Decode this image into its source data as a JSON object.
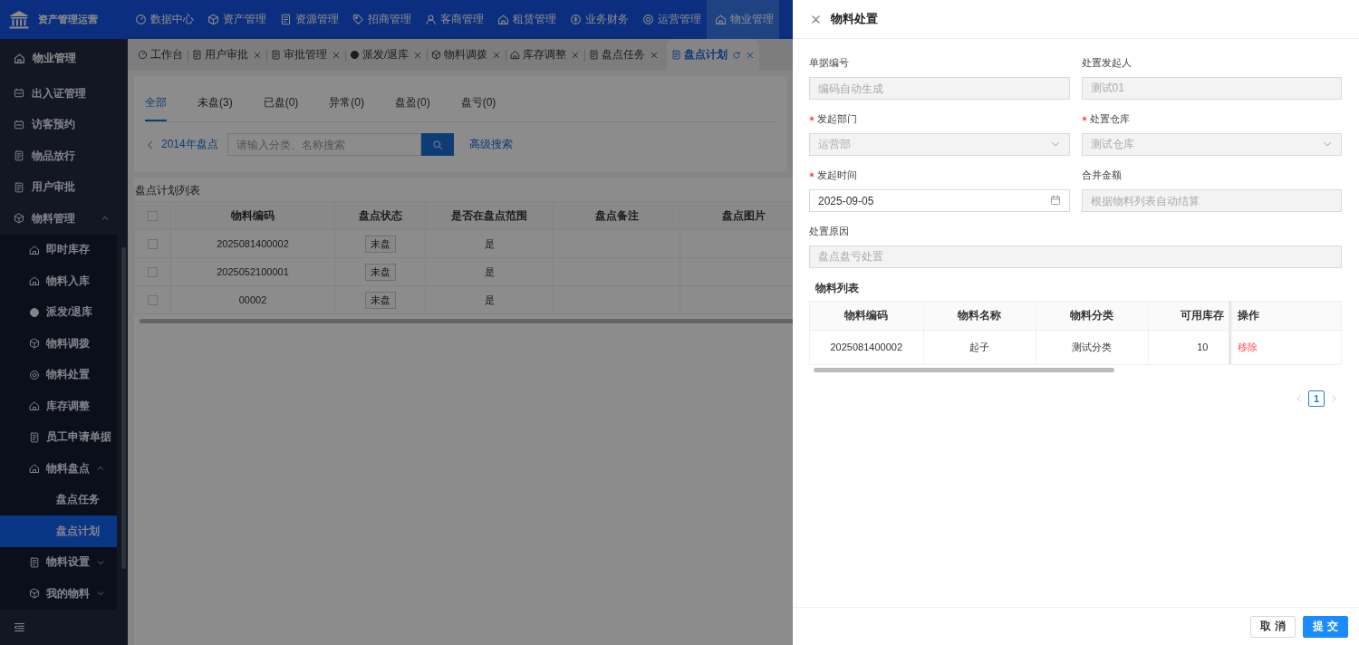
{
  "header": {
    "brand": "资产管理运营",
    "nav": [
      {
        "label": "数据中心",
        "selected": false
      },
      {
        "label": "资产管理",
        "selected": false
      },
      {
        "label": "资源管理",
        "selected": false
      },
      {
        "label": "招商管理",
        "selected": false
      },
      {
        "label": "客商管理",
        "selected": false
      },
      {
        "label": "租赁管理",
        "selected": false
      },
      {
        "label": "业务财务",
        "selected": false
      },
      {
        "label": "运营管理",
        "selected": false
      },
      {
        "label": "物业管理",
        "selected": true
      }
    ]
  },
  "sidebar": {
    "title": "物业管理",
    "items": [
      {
        "label": "出入证管理",
        "selected": false
      },
      {
        "label": "访客预约",
        "selected": false
      },
      {
        "label": "物品放行",
        "selected": false
      },
      {
        "label": "用户审批",
        "selected": false
      },
      {
        "label": "物料管理",
        "selected": false,
        "expanded": true,
        "children": [
          {
            "label": "即时库存",
            "selected": false
          },
          {
            "label": "物料入库",
            "selected": false
          },
          {
            "label": "派发/退库",
            "selected": false
          },
          {
            "label": "物料调拨",
            "selected": false
          },
          {
            "label": "物料处置",
            "selected": false
          },
          {
            "label": "库存调整",
            "selected": false
          },
          {
            "label": "员工申请单据",
            "selected": false
          },
          {
            "label": "物料盘点",
            "selected": false,
            "expanded": true,
            "children": [
              {
                "label": "盘点任务",
                "selected": false
              },
              {
                "label": "盘点计划",
                "selected": true
              }
            ]
          },
          {
            "label": "物料设置",
            "selected": false,
            "expanded": false
          },
          {
            "label": "我的物料",
            "selected": false,
            "expanded": false
          }
        ]
      }
    ]
  },
  "tabs": [
    {
      "label": "工作台",
      "selected": false,
      "closable": false
    },
    {
      "label": "用户审批",
      "selected": false,
      "closable": true
    },
    {
      "label": "审批管理",
      "selected": false,
      "closable": true
    },
    {
      "label": "派发/退库",
      "selected": false,
      "closable": true
    },
    {
      "label": "物料调拨",
      "selected": false,
      "closable": true
    },
    {
      "label": "库存调整",
      "selected": false,
      "closable": true
    },
    {
      "label": "盘点任务",
      "selected": false,
      "closable": true
    },
    {
      "label": "盘点计划",
      "selected": true,
      "closable": true
    }
  ],
  "filter_tabs": [
    {
      "label": "全部",
      "selected": true
    },
    {
      "label": "未盘(3)",
      "selected": false
    },
    {
      "label": "已盘(0)",
      "selected": false
    },
    {
      "label": "异常(0)",
      "selected": false
    },
    {
      "label": "盘盈(0)",
      "selected": false
    },
    {
      "label": "盘亏(0)",
      "selected": false
    }
  ],
  "search": {
    "back_label": "2014年盘点",
    "placeholder": "请输入分类、名称搜索",
    "advanced_label": "高级搜索"
  },
  "plan_table": {
    "title": "盘点计划列表",
    "all_checked": false,
    "columns": [
      "物料编码",
      "盘点状态",
      "是否在盘点范围",
      "盘点备注",
      "盘点图片"
    ],
    "rows": [
      {
        "checked": false,
        "code": "2025081400002",
        "status": "未盘",
        "in_scope": "是"
      },
      {
        "checked": false,
        "code": "2025052100001",
        "status": "未盘",
        "in_scope": "是"
      },
      {
        "checked": false,
        "code": "00002",
        "status": "未盘",
        "in_scope": "是"
      }
    ]
  },
  "drawer": {
    "title": "物料处置",
    "field_rows": [
      [
        {
          "label": "单据编号",
          "required": false,
          "kind": "text",
          "placeholder": "编码自动生成",
          "disabled": true
        },
        {
          "label": "处置发起人",
          "required": false,
          "kind": "text",
          "value": "测试01",
          "disabled": true
        }
      ],
      [
        {
          "label": "发起部门",
          "required": true,
          "kind": "select",
          "value": "运营部",
          "disabled": true
        },
        {
          "label": "处置仓库",
          "required": true,
          "kind": "select",
          "value": "测试仓库",
          "disabled": true
        }
      ],
      [
        {
          "label": "发起时间",
          "required": true,
          "kind": "date",
          "value": "2025-09-05",
          "disabled": false
        },
        {
          "label": "合并金额",
          "required": false,
          "kind": "text",
          "placeholder": "根据物料列表自动结算",
          "disabled": true
        }
      ],
      [
        {
          "label": "处置原因",
          "required": false,
          "kind": "text",
          "value": "盘点盘亏处置",
          "disabled": true
        }
      ]
    ],
    "material_table": {
      "title": "物料列表",
      "columns": [
        "物料编码",
        "物料名称",
        "物料分类",
        "可用库存",
        "操作"
      ],
      "rows": [
        {
          "cells": [
            "2025081400002",
            "起子",
            "测试分类",
            "10"
          ],
          "action": "移除"
        }
      ]
    },
    "pagination": [
      {
        "label": "1",
        "selected": true
      }
    ],
    "buttons": [
      {
        "label": "取 消",
        "kind": "default"
      },
      {
        "label": "提 交",
        "kind": "primary"
      }
    ]
  }
}
